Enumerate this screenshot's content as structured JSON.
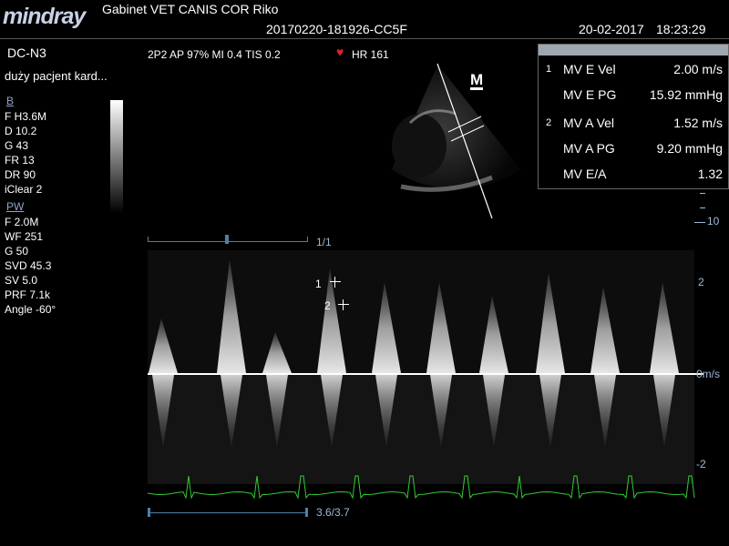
{
  "header": {
    "brand": "mindray",
    "clinic_line": "Gabinet VET CANIS COR  Riko",
    "exam_id": "20170220-181926-CC5F",
    "date": "20-02-2017",
    "time": "18:23:29"
  },
  "probe": {
    "mode": "DC-N3",
    "preset": "duży pacjent kard...",
    "params": "2P2  AP 97%  MI 0.4  TIS 0.2",
    "hr_label": "HR 161"
  },
  "b_section": {
    "title": "B",
    "items": [
      "F H3.6M",
      "D 10.2",
      "G 43",
      "FR 13",
      "DR 90",
      "iClear 2"
    ]
  },
  "pw_section": {
    "title": "PW",
    "items": [
      "F 2.0M",
      "WF 251",
      "G 50",
      "SVD 45.3",
      "SV 5.0",
      "PRF 7.1k",
      "Angle -60°"
    ]
  },
  "measurements": [
    {
      "index": "1",
      "label": "MV E Vel",
      "value": "2.00 m/s"
    },
    {
      "index": "",
      "label": "MV E PG",
      "value": "15.92 mmHg"
    },
    {
      "index": "2",
      "label": "MV A Vel",
      "value": "1.52 m/s"
    },
    {
      "index": "",
      "label": "MV A PG",
      "value": "9.20 mmHg"
    },
    {
      "index": "",
      "label": "MV E/A",
      "value": "1.32"
    }
  ],
  "m_marker": "M",
  "depth_label": "10",
  "image_counter": "1/1",
  "cine_counter": "3.6/3.7",
  "doppler_axis": {
    "top": "2",
    "baseline": "0m/s",
    "bottom": "-2"
  },
  "cursor_labels": [
    "1",
    "2"
  ],
  "colors": {
    "logo": "#c8d2e6",
    "measure_header": "#9ea7b0",
    "ecg": "#33cc33",
    "hr_heart": "#e0202a",
    "scale": "#4f7fa8"
  }
}
